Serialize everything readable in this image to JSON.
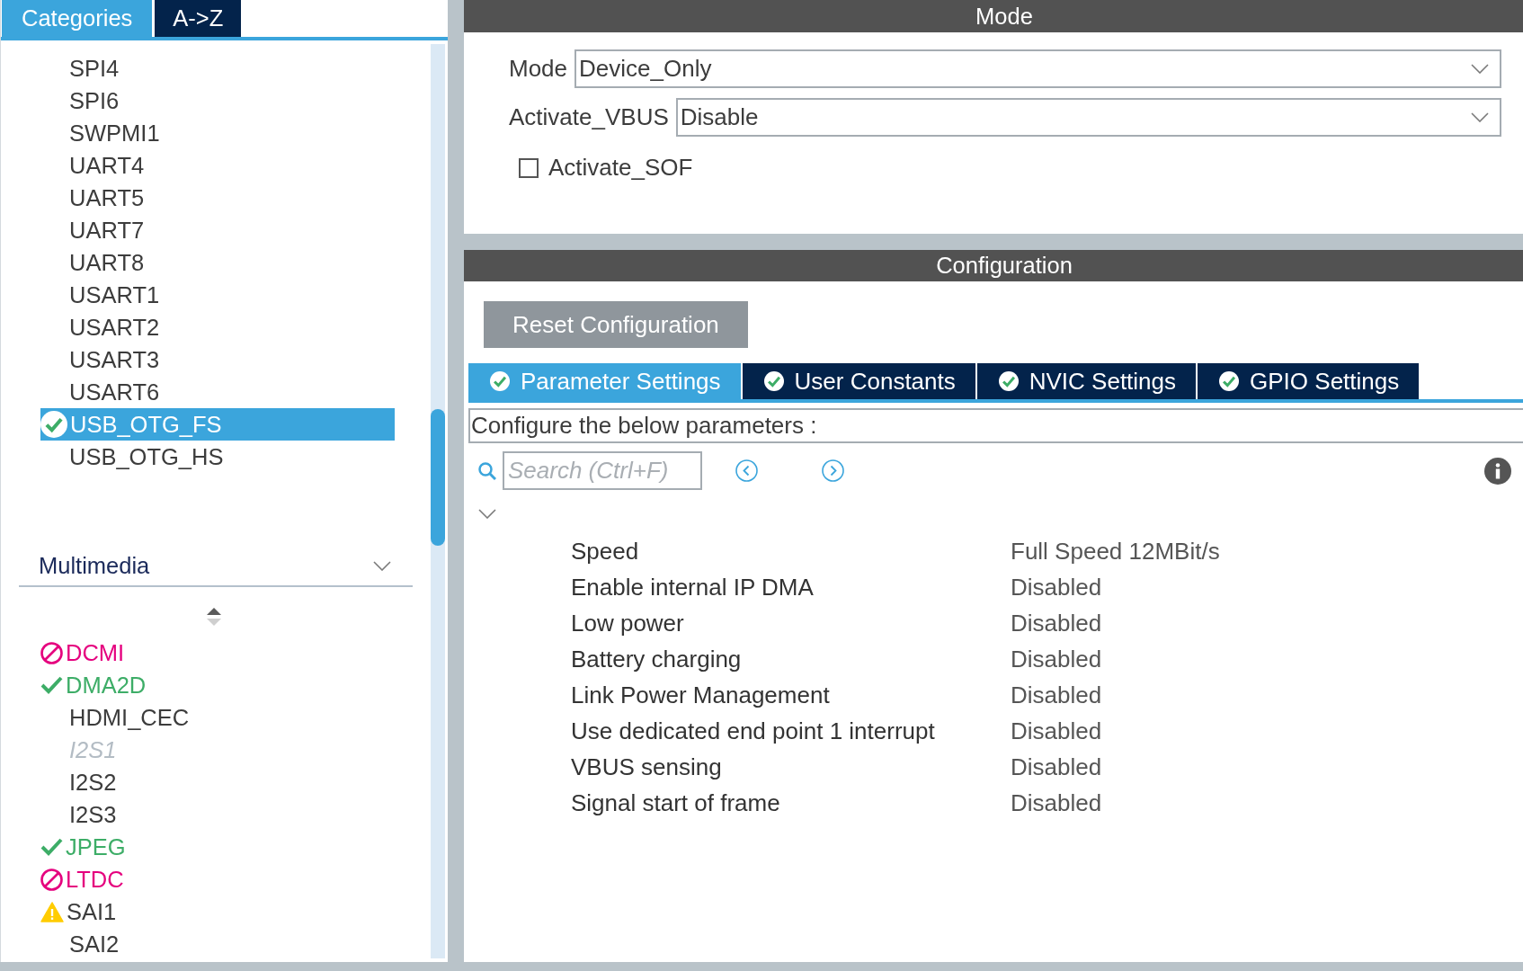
{
  "sidebar": {
    "tabs": [
      {
        "label": "Categories",
        "selected": true
      },
      {
        "label": "A->Z",
        "selected": false
      }
    ],
    "items": [
      {
        "label": "SPI4",
        "kind": "plain",
        "selected": false
      },
      {
        "label": "SPI6",
        "kind": "plain",
        "selected": false
      },
      {
        "label": "SWPMI1",
        "kind": "plain",
        "selected": false
      },
      {
        "label": "UART4",
        "kind": "plain",
        "selected": false
      },
      {
        "label": "UART5",
        "kind": "plain",
        "selected": false
      },
      {
        "label": "UART7",
        "kind": "plain",
        "selected": false
      },
      {
        "label": "UART8",
        "kind": "plain",
        "selected": false
      },
      {
        "label": "USART1",
        "kind": "plain",
        "selected": false
      },
      {
        "label": "USART2",
        "kind": "plain",
        "selected": false
      },
      {
        "label": "USART3",
        "kind": "plain",
        "selected": false
      },
      {
        "label": "USART6",
        "kind": "plain",
        "selected": false
      },
      {
        "label": "USB_OTG_FS",
        "kind": "ok",
        "selected": true
      },
      {
        "label": "USB_OTG_HS",
        "kind": "plain",
        "selected": false
      }
    ],
    "category": {
      "title": "Multimedia",
      "expanded": true
    },
    "category_items": [
      {
        "label": "DCMI",
        "kind": "blocked",
        "selected": false
      },
      {
        "label": "DMA2D",
        "kind": "ok",
        "selected": false
      },
      {
        "label": "HDMI_CEC",
        "kind": "plain",
        "selected": false
      },
      {
        "label": "I2S1",
        "kind": "unavailable",
        "selected": false
      },
      {
        "label": "I2S2",
        "kind": "plain",
        "selected": false
      },
      {
        "label": "I2S3",
        "kind": "plain",
        "selected": false
      },
      {
        "label": "JPEG",
        "kind": "ok",
        "selected": false
      },
      {
        "label": "LTDC",
        "kind": "blocked",
        "selected": false
      },
      {
        "label": "SAI1",
        "kind": "warning",
        "selected": false
      },
      {
        "label": "SAI2",
        "kind": "plain",
        "selected": false
      }
    ]
  },
  "mode": {
    "title": "Mode",
    "fields": [
      {
        "label": "Mode",
        "value": "Device_Only"
      },
      {
        "label": "Activate_VBUS",
        "value": "Disable"
      }
    ],
    "checkbox": {
      "label": "Activate_SOF",
      "checked": false
    }
  },
  "configuration": {
    "title": "Configuration",
    "reset_button": "Reset Configuration",
    "tabs": [
      {
        "label": "Parameter Settings",
        "selected": true
      },
      {
        "label": "User Constants",
        "selected": false
      },
      {
        "label": "NVIC Settings",
        "selected": false
      },
      {
        "label": "GPIO Settings",
        "selected": false
      }
    ],
    "description": "Configure the below parameters :",
    "search": {
      "placeholder": "Search (Ctrl+F)"
    },
    "group": {
      "expanded": true
    },
    "parameters": [
      {
        "name": "Speed",
        "value": "Full Speed 12MBit/s"
      },
      {
        "name": "Enable internal IP DMA",
        "value": "Disabled"
      },
      {
        "name": "Low power",
        "value": "Disabled"
      },
      {
        "name": "Battery charging",
        "value": "Disabled"
      },
      {
        "name": "Link Power Management",
        "value": "Disabled"
      },
      {
        "name": "Use dedicated end point 1 interrupt",
        "value": "Disabled"
      },
      {
        "name": "VBUS sensing",
        "value": "Disabled"
      },
      {
        "name": "Signal start of frame",
        "value": "Disabled"
      }
    ]
  }
}
